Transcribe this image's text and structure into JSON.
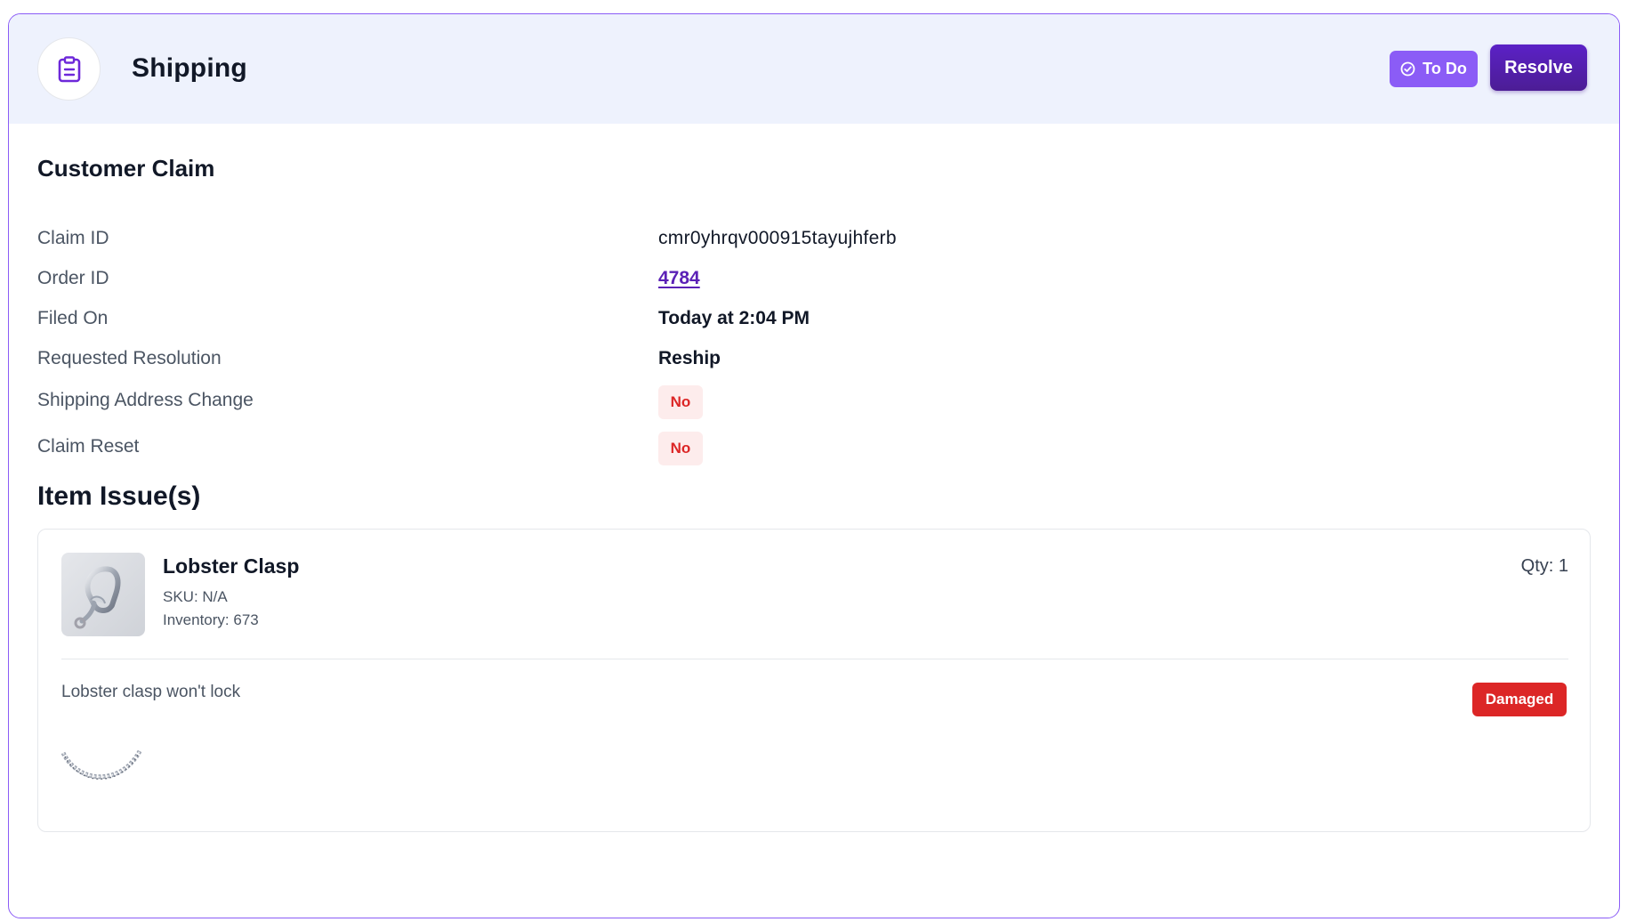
{
  "header": {
    "title": "Shipping",
    "icon": "clipboard-icon",
    "status_badge": "To Do",
    "status_icon": "check-circle-icon",
    "resolve_label": "Resolve"
  },
  "claim": {
    "section_title": "Customer Claim",
    "rows": [
      {
        "label": "Claim ID",
        "value": "cmr0yhrqv000915tayujhferb"
      },
      {
        "label": "Order ID",
        "value": "4784"
      },
      {
        "label": "Filed On",
        "value": "Today at 2:04 PM"
      },
      {
        "label": "Requested Resolution",
        "value": "Reship"
      },
      {
        "label": "Shipping Address Change",
        "value": "No"
      },
      {
        "label": "Claim Reset",
        "value": "No"
      }
    ]
  },
  "items": {
    "section_title": "Item Issue(s)",
    "list": [
      {
        "name": "Lobster Clasp",
        "sku": "SKU: N/A",
        "inventory": "Inventory: 673",
        "qty": "Qty: 1",
        "issue_text": "Lobster clasp won't lock",
        "issue_badge": "Damaged",
        "image": "lobster-clasp-image",
        "attachment": "chain-photo-image"
      }
    ]
  },
  "colors": {
    "accent": "#8b5cf6",
    "primary": "#5b21b6",
    "header_bg": "#eef2fd",
    "danger": "#dc2626",
    "danger_bg": "#fdecec"
  }
}
